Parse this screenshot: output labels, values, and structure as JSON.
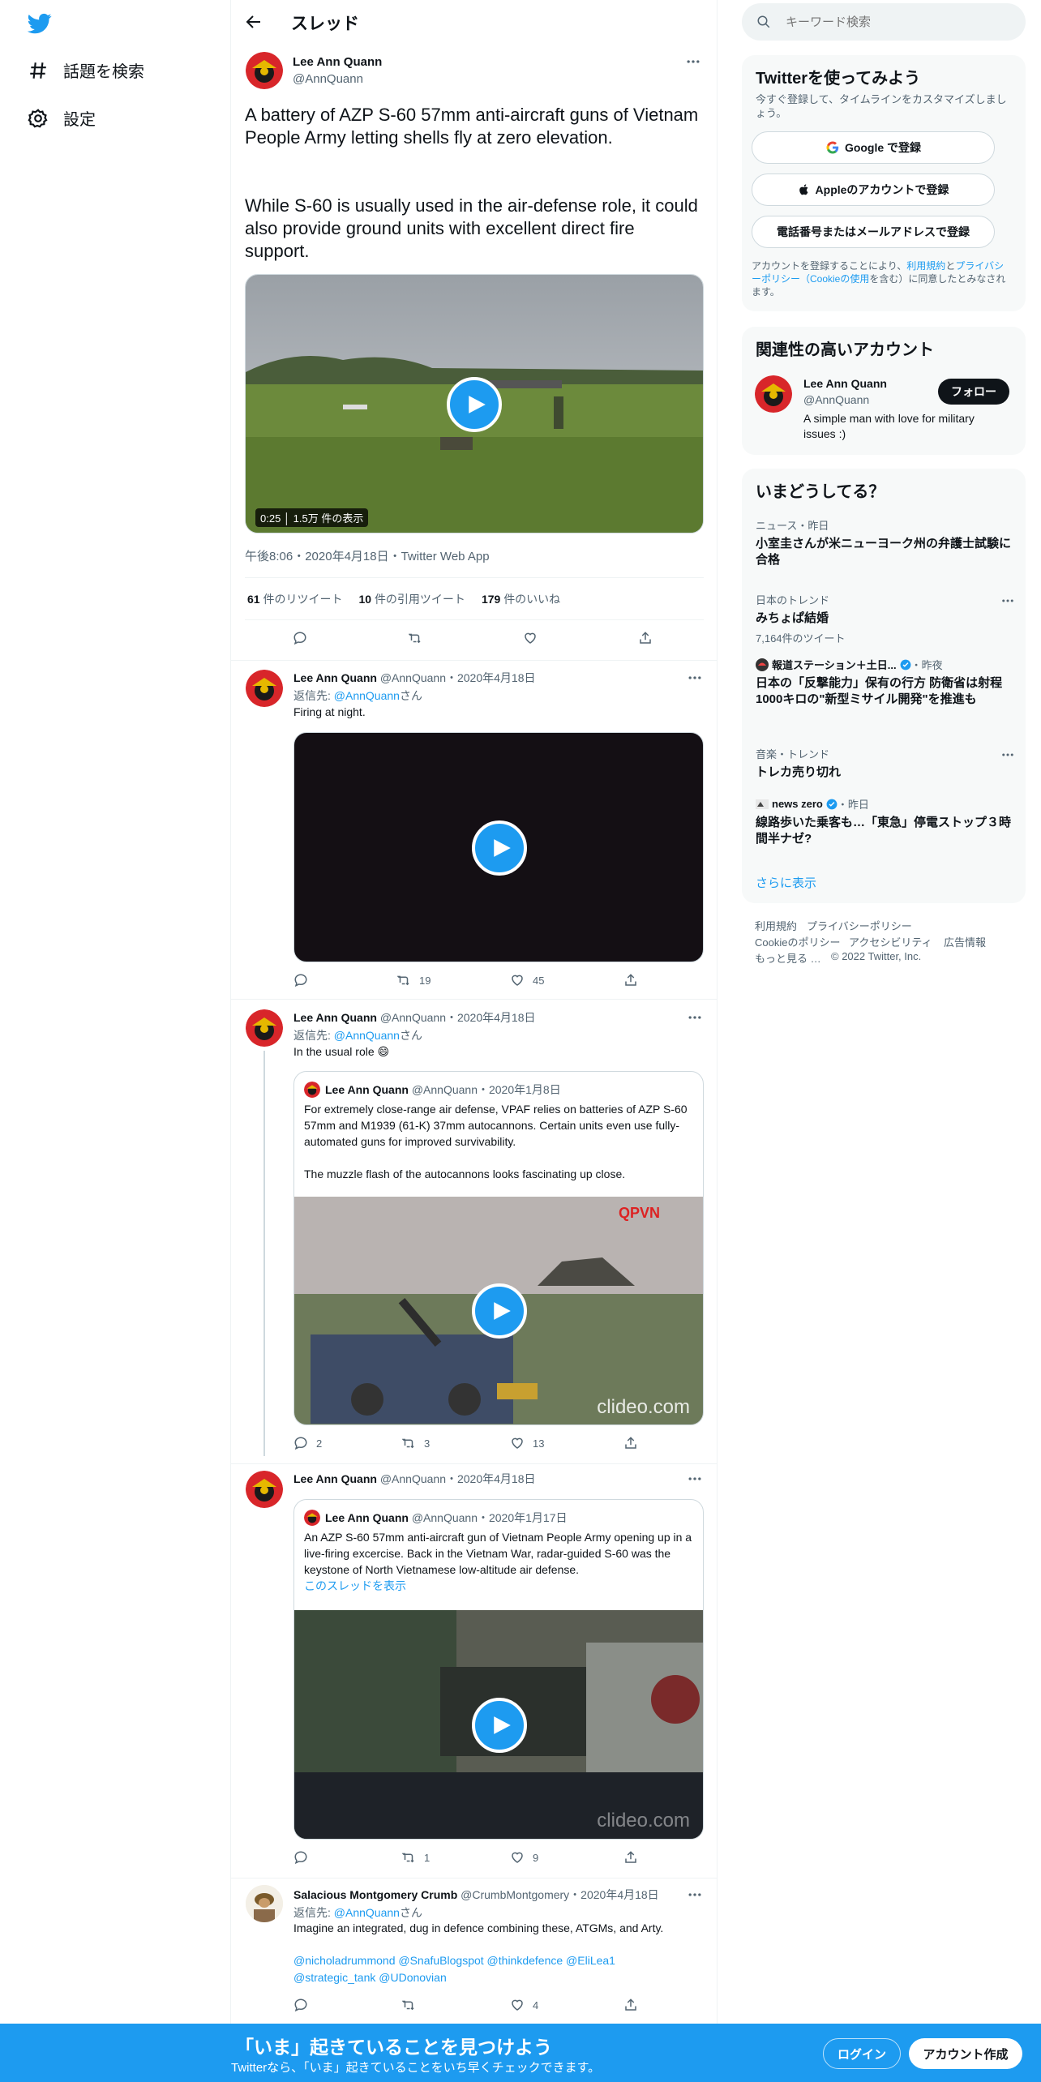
{
  "nav": {
    "explore": "話題を検索",
    "settings": "設定"
  },
  "header": {
    "title": "スレッド"
  },
  "main": {
    "name": "Lee Ann Quann",
    "handle": "@AnnQuann",
    "text1": "A battery of AZP S-60 57mm anti-aircraft guns of Vietnam People Army letting shells fly at zero elevation.",
    "text2": "While S-60 is usually used in the air-defense role, it could also provide ground units with excellent direct fire support.",
    "video_time": "0:25",
    "video_views": "1.5万 件の表示",
    "meta": "午後8:06・2020年4月18日・Twitter Web App",
    "retweets_count": "61",
    "retweets_label": "件のリツイート",
    "quotes_count": "10",
    "quotes_label": "件の引用ツイート",
    "likes_count": "179",
    "likes_label": "件のいいね"
  },
  "replies": [
    {
      "name": "Lee Ann Quann",
      "handle_date": "@AnnQuann・2020年4月18日",
      "reply_to_prefix": "返信先: ",
      "reply_to_handle": "@AnnQuann",
      "reply_to_suffix": "さん",
      "text": "Firing at night.",
      "retweets": "19",
      "likes": "45"
    },
    {
      "name": "Lee Ann Quann",
      "handle_date": "@AnnQuann・2020年4月18日",
      "reply_to_prefix": "返信先: ",
      "reply_to_handle": "@AnnQuann",
      "reply_to_suffix": "さん",
      "text": "In the usual role 😄",
      "quote": {
        "name": "Lee Ann Quann",
        "handle_date": "@AnnQuann・2020年1月8日",
        "text1": "For extremely close-range air defense, VPAF relies on batteries of AZP S-60 57mm and M1939 (61-K) 37mm autocannons. Certain units even use fully-automated guns for improved survivability.",
        "text2": "The muzzle flash of the autocannons looks fascinating up close.",
        "watermark": "clideo.com",
        "logo": "QPVN"
      },
      "comments": "2",
      "retweets": "3",
      "likes": "13"
    },
    {
      "name": "Lee Ann Quann",
      "handle_date": "@AnnQuann・2020年4月18日",
      "quote": {
        "name": "Lee Ann Quann",
        "handle_date": "@AnnQuann・2020年1月17日",
        "text": "An AZP S-60 57mm anti-aircraft gun of Vietnam People Army opening up in a live-firing excercise. Back in the Vietnam War, radar-guided S-60 was the keystone of North Vietnamese low-altitude air defense.",
        "thread_link": "このスレッドを表示",
        "watermark": "clideo.com"
      },
      "retweets": "1",
      "likes": "9"
    },
    {
      "name": "Salacious Montgomery Crumb",
      "handle_date": "@CrumbMontgomery・2020年4月18日",
      "reply_to_prefix": "返信先: ",
      "reply_to_handle": "@AnnQuann",
      "reply_to_suffix": "さん",
      "text": "Imagine an integrated, dug in defence combining these, ATGMs, and Arty.",
      "mentions1": "@nicholadrummond @SnafuBlogspot @thinkdefence @EliLea1",
      "mentions2": "@strategic_tank @UDonovian",
      "likes": "4"
    }
  ],
  "search": {
    "placeholder": "キーワード検索"
  },
  "signup": {
    "title": "Twitterを使ってみよう",
    "subtitle": "今すぐ登録して、タイムラインをカスタマイズしましょう。",
    "google": "Google で登録",
    "apple": "Appleのアカウントで登録",
    "phone": "電話番号またはメールアドレスで登録",
    "terms_1": "アカウントを登録することにより、",
    "terms_link1": "利用規約",
    "terms_2": "と",
    "terms_link2": "プライバシーポリシー（Cookieの使用",
    "terms_3": "を含む）に同意したとみなされます。"
  },
  "related": {
    "title": "関連性の高いアカウント",
    "name": "Lee Ann Quann",
    "handle": "@AnnQuann",
    "bio": "A simple man with love for military issues :)",
    "follow": "フォロー"
  },
  "trends": {
    "title": "いまどうしてる？",
    "items": [
      {
        "meta": "ニュース・昨日",
        "headline": "小室圭さんが米ニューヨーク州の弁護士試験に合格",
        "count": ""
      },
      {
        "meta": "日本のトレンド",
        "headline": "みちょぱ結婚",
        "count": "7,164件のツイート"
      },
      {
        "meta": "報道ステーション＋土日...",
        "meta2": "・昨夜",
        "headline": "日本の「反撃能力」保有の行方 防衛省は射程1000キロの\"新型ミサイル開発\"を推進も",
        "count": ""
      },
      {
        "meta": "音楽・トレンド",
        "headline": "トレカ売り切れ",
        "count": ""
      },
      {
        "meta": "news zero",
        "meta2": "・昨日",
        "headline": "線路歩いた乗客も…「東急」停電ストップ３時間半ナゼ?",
        "count": ""
      }
    ],
    "show_more": "さらに表示"
  },
  "footer": {
    "terms": "利用規約",
    "privacy": "プライバシーポリシー",
    "cookie": "Cookieのポリシー",
    "accessibility": "アクセシビリティ",
    "ads": "広告情報",
    "more": "もっと見る …",
    "copyright": "© 2022 Twitter, Inc."
  },
  "banner": {
    "title": "「いま」起きていることを見つけよう",
    "subtitle": "Twitterなら、「いま」起きていることをいち早くチェックできます。",
    "login": "ログイン",
    "signup": "アカウント作成"
  },
  "colors": {
    "accent": "#1d9bf0",
    "text": "#0f1419",
    "secondary": "#536471"
  }
}
